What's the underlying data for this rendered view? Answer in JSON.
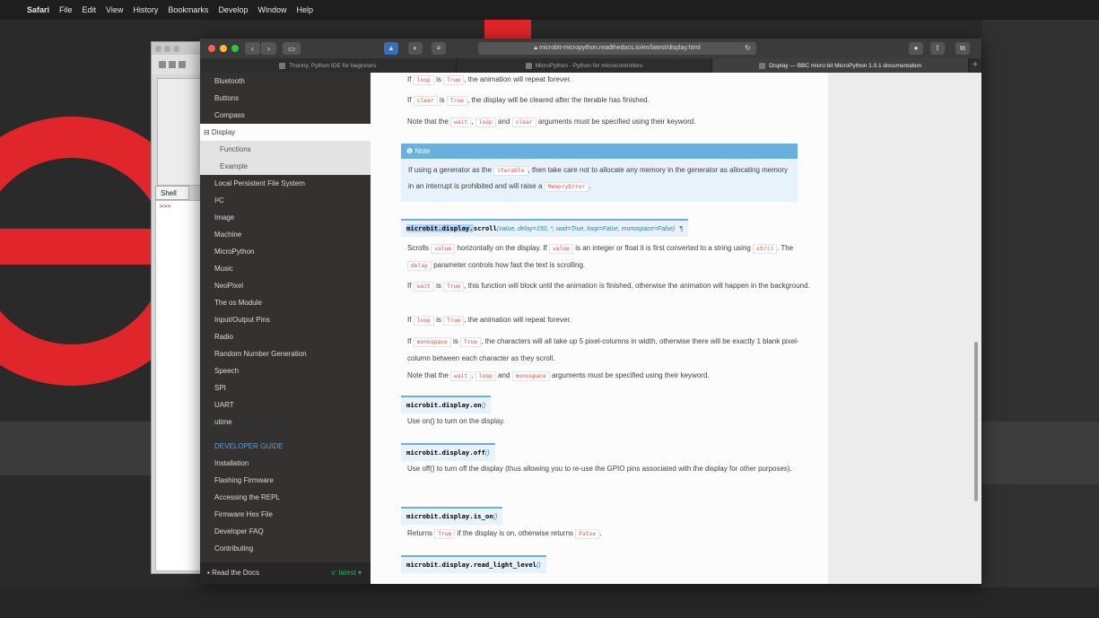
{
  "menubar": {
    "apple": "",
    "app": "Safari",
    "items": [
      "File",
      "Edit",
      "View",
      "History",
      "Bookmarks",
      "Develop",
      "Window",
      "Help"
    ]
  },
  "thonny": {
    "shell_tab": "Shell",
    "prompt": ">>>"
  },
  "browser": {
    "url": "microbit-micropython.readthedocs.io/en/latest/display.html",
    "tabs": [
      {
        "label": "Thonny, Python IDE for beginners",
        "active": false
      },
      {
        "label": "MicroPython - Python for microcontrollers",
        "active": false
      },
      {
        "label": "Display — BBC micro:bit MicroPython 1.0.1 documentation",
        "active": true
      }
    ]
  },
  "sidebar": {
    "items": [
      "Bluetooth",
      "Buttons",
      "Compass"
    ],
    "current": "⊟ Display",
    "sub_items": [
      "Functions",
      "Example"
    ],
    "items_after": [
      "Local Persistent File System",
      "I²C",
      "Image",
      "Machine",
      "MicroPython",
      "Music",
      "NeoPixel",
      "The os Module",
      "Input/Output Pins",
      "Radio",
      "Random Number Generation",
      "Speech",
      "SPI",
      "UART",
      "utime"
    ],
    "caption": "DEVELOPER GUIDE",
    "dev_items": [
      "Installation",
      "Flashing Firmware",
      "Accessing the REPL",
      "Firmware Hex File",
      "Developer FAQ",
      "Contributing"
    ],
    "footer_rtd": "Read the Docs",
    "footer_version": "v: latest ▾"
  },
  "content": {
    "p1": {
      "pre": "If ",
      "c1": "loop",
      "mid": " is ",
      "c2": "True",
      "post": ", the animation will repeat forever."
    },
    "p2": {
      "pre": "If ",
      "c1": "clear",
      "mid": " is ",
      "c2": "True",
      "post": ", the display will be cleared after the iterable has finished."
    },
    "p3": {
      "pre": "Note that the ",
      "c1": "wait",
      "s1": ", ",
      "c2": "loop",
      "s2": " and ",
      "c3": "clear",
      "post": " arguments must be specified using their keyword."
    },
    "note": {
      "title": "Note",
      "t1": "If using a generator as the ",
      "c1": "iterable",
      "t2": ", then take care not to allocate any memory in the generator as allocating memory in an interrupt is prohibited and will raise a ",
      "c2": "MemoryError",
      "t3": "."
    },
    "scroll_sig": {
      "mod": "microbit.display.",
      "fn": "scroll",
      "params": "(value, delay=150, *, wait=True, loop=False, monospace=False)",
      "link": "¶"
    },
    "s1": {
      "t1": "Scrolls ",
      "c1": "value",
      "t2": " horizontally on the display. If ",
      "c2": "value",
      "t3": " is an integer or float it is first converted to a string using ",
      "c3": "str()",
      "t4": ". The ",
      "c4": "delay",
      "t5": " parameter controls how fast the text is scrolling."
    },
    "s2": {
      "t1": "If ",
      "c1": "wait",
      "t2": " is ",
      "c2": "True",
      "t3": ", this function will block until the animation is finished, otherwise the animation will happen in the background."
    },
    "s3": {
      "t1": "If ",
      "c1": "loop",
      "t2": " is ",
      "c2": "True",
      "t3": ", the animation will repeat forever."
    },
    "s4": {
      "t1": "If ",
      "c1": "monospace",
      "t2": " is ",
      "c2": "True",
      "t3": ", the characters will all take up 5 pixel-columns in width, otherwise there will be exactly 1 blank pixel-column between each character as they scroll."
    },
    "s5": {
      "t1": "Note that the ",
      "c1": "wait",
      "t2": ", ",
      "c2": "loop",
      "t3": " and ",
      "c3": "monospace",
      "t4": " arguments must be specified using their keyword."
    },
    "on_sig": {
      "mod": "microbit.display.",
      "fn": "on",
      "params": "()"
    },
    "on_desc": "Use on() to turn on the display.",
    "off_sig": {
      "mod": "microbit.display.",
      "fn": "off",
      "params": "()"
    },
    "off_desc": "Use off() to turn off the display (thus allowing you to re-use the GPIO pins associated with the display for other purposes).",
    "ison_sig": {
      "mod": "microbit.display.",
      "fn": "is_on",
      "params": "()"
    },
    "ison_desc": {
      "t1": "Returns ",
      "c1": "True",
      "t2": " if the display is on, otherwise returns ",
      "c2": "False",
      "t3": "."
    },
    "rll_sig": {
      "mod": "microbit.display.",
      "fn": "read_light_level",
      "params": "()"
    }
  }
}
